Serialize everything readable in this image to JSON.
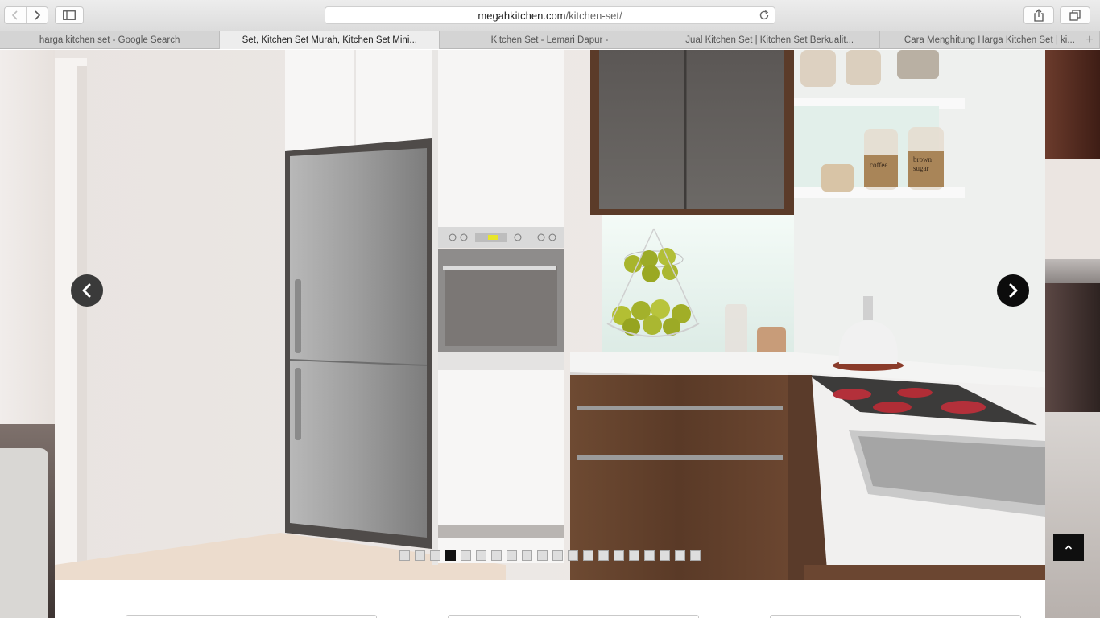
{
  "browser": {
    "url_domain": "megahkitchen.com",
    "url_path": "/kitchen-set/",
    "tabs": [
      {
        "label": "harga kitchen set - Google Search",
        "active": false
      },
      {
        "label": "Set, Kitchen Set Murah, Kitchen Set Mini...",
        "active": true
      },
      {
        "label": "Kitchen Set - Lemari Dapur -",
        "active": false
      },
      {
        "label": "Jual Kitchen Set | Kitchen Set Berkualit...",
        "active": false
      },
      {
        "label": "Cara Menghitung Harga Kitchen Set | ki...",
        "active": false
      }
    ],
    "new_tab_label": "+",
    "icons": {
      "back": "chevron-left-icon",
      "forward": "chevron-right-icon",
      "sidebar": "sidebar-icon",
      "reload": "reload-icon",
      "share": "share-icon",
      "tabs_overview": "tabs-overview-icon"
    }
  },
  "slider": {
    "image_subject": "kitchen set interior render",
    "total_slides": 20,
    "active_slide": 4,
    "dots": [
      1,
      2,
      3,
      4,
      5,
      6,
      7,
      8,
      9,
      10,
      11,
      12,
      13,
      14,
      15,
      16,
      17,
      18,
      19,
      20
    ],
    "image_text": {
      "oven_display": "---",
      "jar_coffee": "coffee",
      "jar_sugar_line1": "brown",
      "jar_sugar_line2": "sugar"
    }
  },
  "colors": {
    "arrow_prev_bg": "#3a3a3a",
    "arrow_next_bg": "#0c0c0c",
    "active_dot": "#111111",
    "inactive_dot": "#dedede"
  }
}
